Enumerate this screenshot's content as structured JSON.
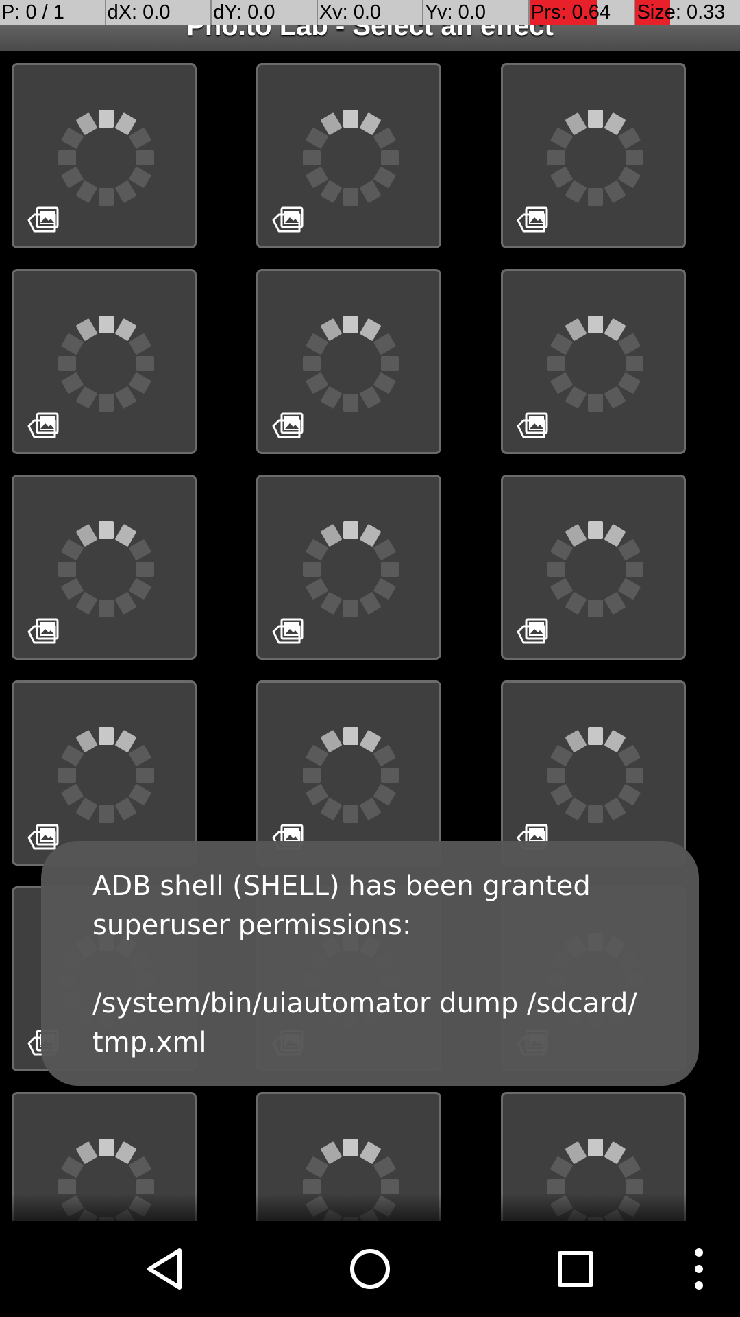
{
  "debug_overlay": {
    "cells": [
      {
        "text": "P: 0 / 1",
        "highlight": false
      },
      {
        "text": "dX: 0.0",
        "highlight": false
      },
      {
        "text": "dY: 0.0",
        "highlight": false
      },
      {
        "text": "Xv: 0.0",
        "highlight": false
      },
      {
        "text": "Yv: 0.0",
        "highlight": false
      },
      {
        "text": "Prs: 0.64",
        "highlight": true,
        "highlight_fraction": 0.64
      },
      {
        "text": "Size: 0.33",
        "highlight": true,
        "highlight_fraction": 0.33
      }
    ],
    "highlight_color": "#e8202a"
  },
  "app": {
    "title": "Pho.to Lab - Select an effect"
  },
  "effects_grid": {
    "columns": 3,
    "tile_count": 18,
    "tile_state": "loading",
    "tile_icon": "gallery-stack-icon",
    "spinner_icon": "loading-spinner-icon"
  },
  "toast": {
    "message": "ADB shell (SHELL) has been granted\nsuperuser permissions:\n\n/system/bin/uiautomator dump /sdcard/\ntmp.xml"
  },
  "navbar": {
    "back_icon": "back-triangle-icon",
    "home_icon": "home-circle-icon",
    "recents_icon": "recents-square-icon",
    "menu_icon": "overflow-menu-icon"
  }
}
